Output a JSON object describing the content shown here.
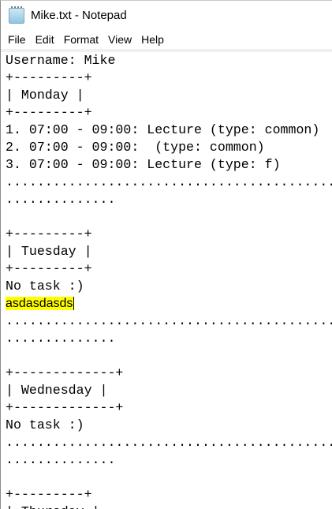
{
  "window": {
    "title": "Mike.txt - Notepad",
    "icon": "notepad-icon"
  },
  "menu": [
    "File",
    "Edit",
    "Format",
    "View",
    "Help"
  ],
  "highlight_color": "#ffff00",
  "lines": [
    "Username: Mike",
    "+---------+",
    "| Monday |",
    "+---------+",
    "1. 07:00 - 09:00: Lecture (type: common)",
    "2. 07:00 - 09:00:  (type: common)",
    "3. 07:00 - 09:00: Lecture (type: f)",
    ".............................................",
    "..............",
    "",
    "+---------+",
    "| Tuesday |",
    "+---------+",
    "No task :)",
    "asdasdasds",
    ".............................................",
    "..............",
    "",
    "+-------------+",
    "| Wednesday |",
    "+-------------+",
    "No task :)",
    ".............................................",
    "..............",
    "",
    "+---------+",
    "| Thursday |"
  ]
}
